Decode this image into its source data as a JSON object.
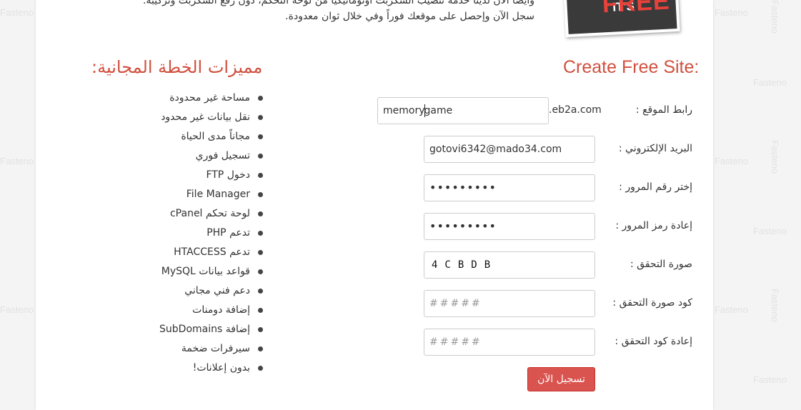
{
  "watermark": "Fasteno",
  "intro": {
    "line1": "وأيضاً الآن لدينا خدمة تنصيب السكربت أوتوماتيكياً من لوحة التحكم، دون رفع السكربت وتركيبه.",
    "line2": "سجل الآن وإحصل على موقعك فوراً وفي خلال ثوان معدودة."
  },
  "badge": {
    "small": "IT'S",
    "big": "FREE"
  },
  "form": {
    "title": "Create Free Site:",
    "site_label": "رابط الموقع :",
    "site_value_before_caret": "memory",
    "site_value_after_caret": "game",
    "site_suffix": ".eb2a.com",
    "email_label": "البريد الإلكتروني :",
    "email_value": "gotovi6342@mado34.com",
    "password_label": "إختر رقم المرور :",
    "password_value": "•••••••••",
    "password_confirm_label": "إعادة رمز المرور :",
    "password_confirm_value": "•••••••••",
    "captcha_label": "صورة التحقق :",
    "captcha_text": "4CBDB",
    "captcha_code_label": "كود صورة التحقق :",
    "captcha_code_placeholder": "#####",
    "captcha_code_confirm_label": "إعادة كود التحقق :",
    "captcha_code_confirm_placeholder": "#####",
    "submit_label": "تسجيل الآن"
  },
  "features": {
    "title": "مميزات الخطة المجانية:",
    "items": [
      "مساحة غير محدودة",
      "نقل بيانات غير محدود",
      "مجاناً مدى الحياة",
      "تسجيل فوري",
      "دخول FTP",
      "File Manager",
      "لوحة تحكم cPanel",
      "تدعم PHP",
      "تدعم HTACCESS",
      "قواعد بيانات MySQL",
      "دعم فني مجاني",
      "إضافة دومنات",
      "إضافة SubDomains",
      "سيرفرات ضخمة",
      "بدون إعلانات!"
    ]
  },
  "colors": {
    "accent": "#d1503e",
    "button": "#d9534f",
    "badge_bg": "#3a3a3a"
  }
}
